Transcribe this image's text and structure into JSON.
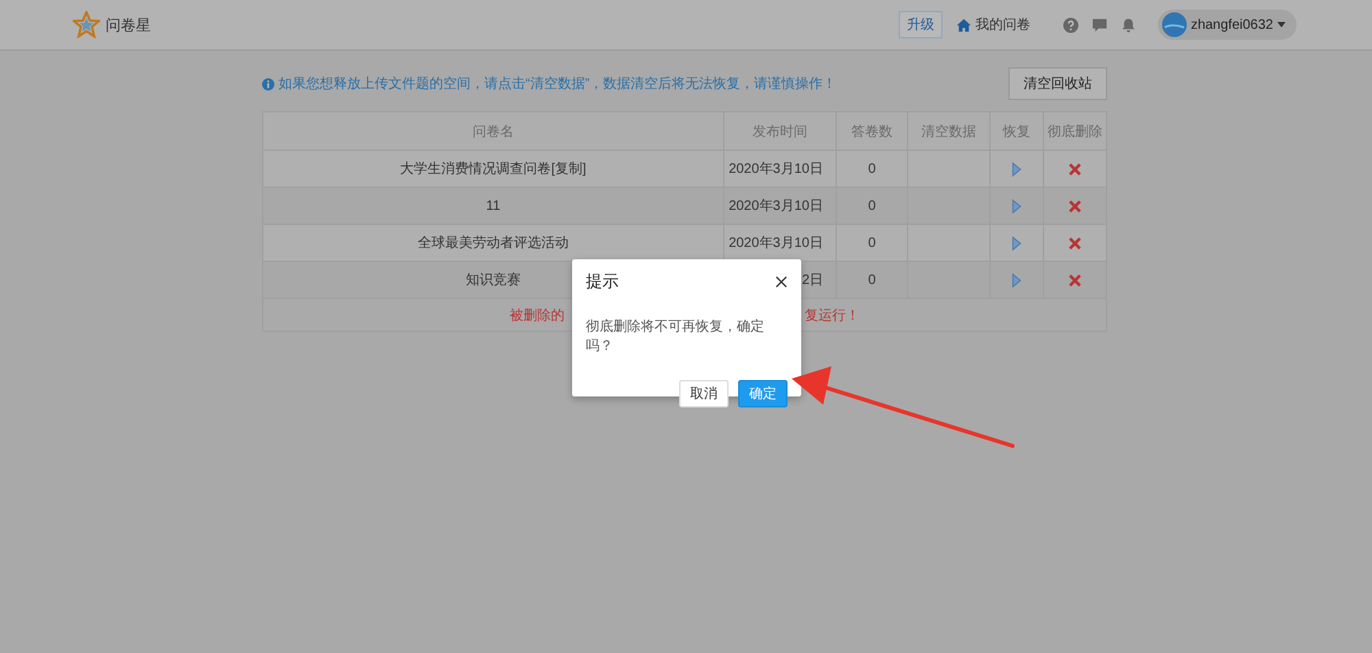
{
  "header": {
    "logo_text": "问卷星",
    "upgrade_button": "升级",
    "my_surveys_link": "我的问卷",
    "username": "zhangfei0632"
  },
  "notice": "如果您想释放上传文件题的空间，请点击“清空数据”，数据清空后将无法恢复，请谨慎操作！",
  "clear_bin_button": "清空回收站",
  "table": {
    "columns": [
      "问卷名",
      "发布时间",
      "答卷数",
      "清空数据",
      "恢复",
      "彻底删除"
    ],
    "rows": [
      {
        "name": "大学生消费情况调查问卷[复制]",
        "date": "2020年3月10日",
        "count": "0"
      },
      {
        "name": "11",
        "date": "2020年3月10日",
        "count": "0"
      },
      {
        "name": "全球最美劳动者评选活动",
        "date": "2020年3月10日",
        "count": "0"
      },
      {
        "name": "知识竞赛",
        "date": "2日",
        "count": "0"
      }
    ],
    "note_parts": [
      "被删除的",
      "复运行！"
    ]
  },
  "dialog": {
    "title": "提示",
    "message": "彻底删除将不可再恢复，确定吗？",
    "buttons": [
      {
        "label": "取消",
        "kind": "secondary"
      },
      {
        "label": "确定",
        "kind": "primary"
      }
    ]
  }
}
